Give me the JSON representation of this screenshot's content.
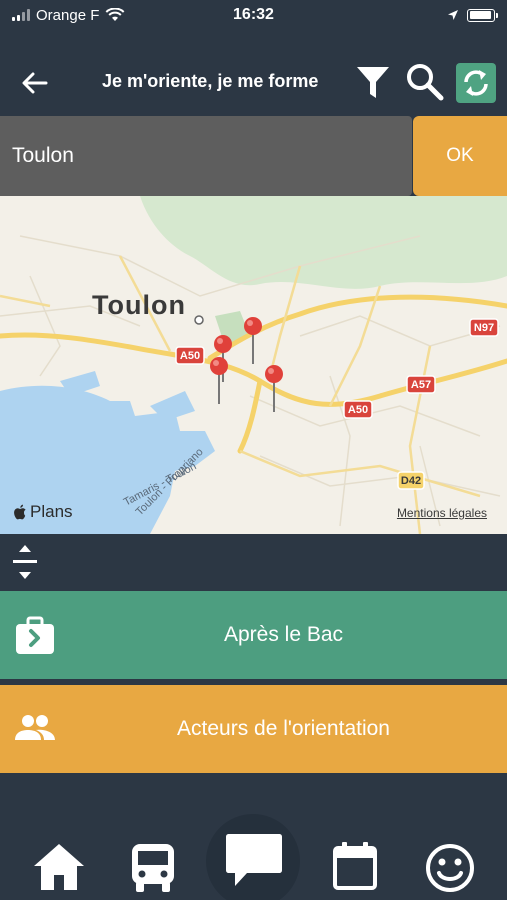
{
  "status_bar": {
    "carrier": "Orange F",
    "time": "16:32",
    "battery_level": 0.95
  },
  "header": {
    "title": "Je m'oriente, je me forme",
    "back_icon": "arrow-left-icon",
    "filter_icon": "filter-icon",
    "search_icon": "search-icon",
    "refresh_icon": "refresh-icon",
    "refresh_color": "#4fa382"
  },
  "search": {
    "value": "Toulon",
    "ok_label": "OK"
  },
  "map": {
    "city_label": "Toulon",
    "credit": "Plans",
    "legal": "Mentions légales",
    "road_labels": [
      "A50",
      "A50",
      "A57",
      "N97",
      "D42"
    ],
    "street_labels": [
      "Tamaris - Toulon",
      "Toulon - Propriano"
    ],
    "pin_count": 4,
    "pin_color": "#e0413a"
  },
  "menu": {
    "items": [
      {
        "label": "Après le Bac",
        "icon": "briefcase-icon",
        "color": "#4d9e80"
      },
      {
        "label": "Acteurs de l'orientation",
        "icon": "people-icon",
        "color": "#e8a842"
      }
    ]
  },
  "bottom_nav": {
    "tabs": [
      "home-icon",
      "bus-icon",
      "chat-icon",
      "calendar-icon",
      "smiley-icon"
    ]
  }
}
